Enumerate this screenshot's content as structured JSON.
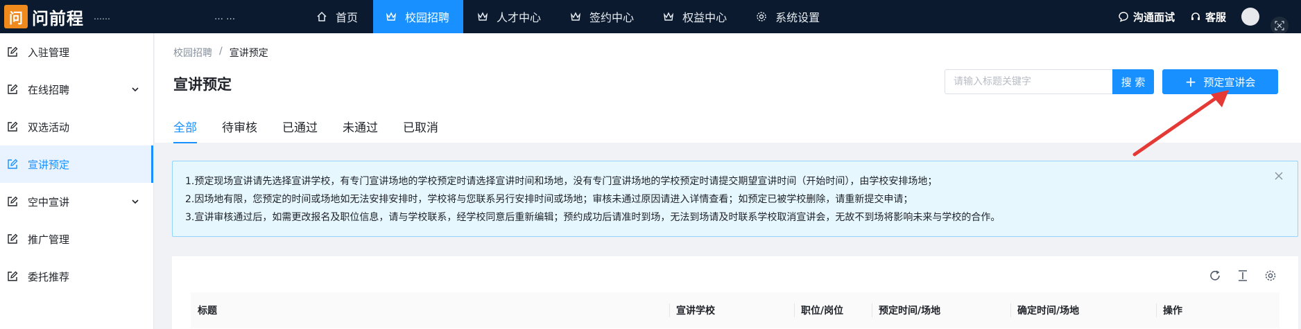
{
  "brand": {
    "logo_char": "问",
    "name": "问前程",
    "sub": "……",
    "tag": "…  …"
  },
  "nav": [
    {
      "label": "首页",
      "icon": "home-icon",
      "active": false
    },
    {
      "label": "校园招聘",
      "icon": "crown-icon",
      "active": true
    },
    {
      "label": "人才中心",
      "icon": "crown-icon",
      "active": false
    },
    {
      "label": "签约中心",
      "icon": "crown-icon",
      "active": false
    },
    {
      "label": "权益中心",
      "icon": "crown-icon",
      "active": false
    },
    {
      "label": "系统设置",
      "icon": "gear-icon",
      "active": false
    }
  ],
  "top_right": {
    "interview": "沟通面试",
    "service": "客服"
  },
  "sidebar": [
    {
      "label": "入驻管理",
      "expandable": false,
      "active": false
    },
    {
      "label": "在线招聘",
      "expandable": true,
      "active": false
    },
    {
      "label": "双选活动",
      "expandable": false,
      "active": false
    },
    {
      "label": "宣讲预定",
      "expandable": false,
      "active": true
    },
    {
      "label": "空中宣讲",
      "expandable": true,
      "active": false
    },
    {
      "label": "推广管理",
      "expandable": false,
      "active": false
    },
    {
      "label": "委托推荐",
      "expandable": false,
      "active": false
    }
  ],
  "breadcrumb": {
    "parent": "校园招聘",
    "separator": "/",
    "current": "宣讲预定"
  },
  "page_title": "宣讲预定",
  "search": {
    "placeholder": "请输入标题关键字",
    "value": "",
    "button": "搜 索"
  },
  "book_button": "预定宣讲会",
  "tabs": [
    {
      "label": "全部",
      "active": true
    },
    {
      "label": "待审核",
      "active": false
    },
    {
      "label": "已通过",
      "active": false
    },
    {
      "label": "未通过",
      "active": false
    },
    {
      "label": "已取消",
      "active": false
    }
  ],
  "notice": [
    "1.预定现场宣讲请先选择宣讲学校，有专门宣讲场地的学校预定时请选择宣讲时间和场地，没有专门宣讲场地的学校预定时请提交期望宣讲时间（开始时间），由学校安排场地；",
    "2.因场地有限，您预定的时间或场地如无法安排安排时，学校将与您联系另行安排时间或场地；审核未通过原因请进入详情查看；如预定已被学校删除，请重新提交申请；",
    "3.宣讲审核通过后，如需更改报名及职位信息，请与学校联系，经学校同意后重新编辑；预约成功后请准时到场，无法到场请及时联系学校取消宣讲会，无故不到场将影响未来与学校的合作。"
  ],
  "table": {
    "columns": [
      "标题",
      "宣讲学校",
      "职位/岗位",
      "预定时间/场地",
      "确定时间/场地",
      "操作"
    ]
  },
  "colors": {
    "primary": "#1890ff",
    "topbar": "#0b1a2e",
    "annotation_arrow": "#e53935"
  }
}
